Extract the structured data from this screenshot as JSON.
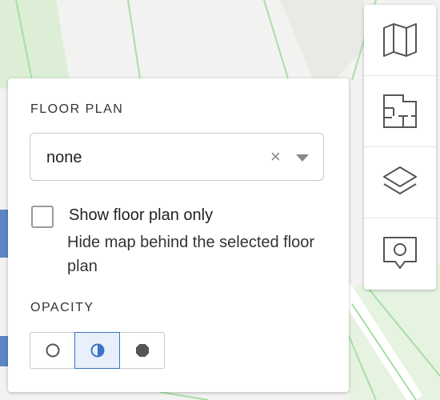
{
  "floor_plan": {
    "title": "FLOOR PLAN",
    "selected": "none",
    "clear_symbol": "×"
  },
  "show_floor_plan_only": {
    "label": "Show floor plan only",
    "description": "Hide map behind the selected floor plan",
    "checked": false
  },
  "opacity": {
    "title": "OPACITY",
    "options": [
      "transparent",
      "half",
      "opaque"
    ],
    "selected": "half"
  },
  "toolbar": {
    "icons": [
      "map-icon",
      "floor-plan-icon",
      "layers-icon",
      "location-pin-icon"
    ]
  },
  "colors": {
    "accent": "#3b73c5",
    "icon": "#555555",
    "map_bg": "#f2f2f0",
    "road_green": "#a6dfa6"
  }
}
